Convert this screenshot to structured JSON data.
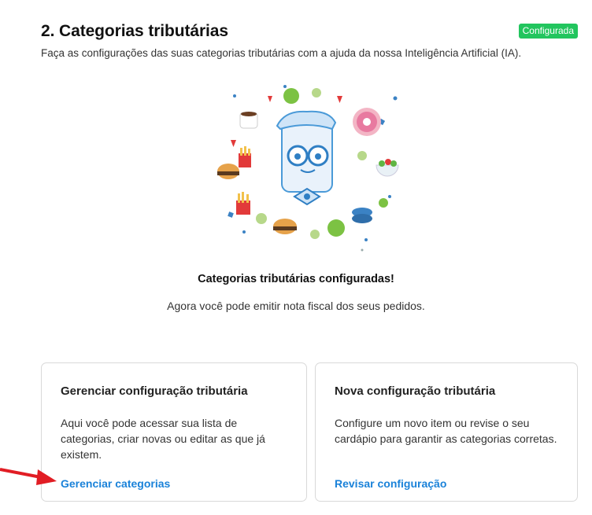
{
  "section": {
    "title": "2. Categorias tributárias",
    "badge": "Configurada",
    "subtitle": "Faça as configurações das suas categorias tributárias com a ajuda da nossa Inteligência Artificial (IA)."
  },
  "success": {
    "title": "Categorias tributárias configuradas!",
    "text": "Agora você pode emitir nota fiscal dos seus pedidos."
  },
  "cards": [
    {
      "title": "Gerenciar configuração tributária",
      "text": "Aqui você pode acessar sua lista de categorias, criar novas ou editar as que já existem.",
      "link": "Gerenciar categorias"
    },
    {
      "title": "Nova configuração tributária",
      "text": "Configure um novo item ou revise o seu cardápio para garantir as categorias corretas.",
      "link": "Revisar configuração"
    }
  ],
  "colors": {
    "badge": "#22c55e",
    "link": "#1a82d9",
    "arrow": "#e11d24"
  },
  "icons": [
    "mascot-illustration",
    "red-arrow-icon"
  ]
}
